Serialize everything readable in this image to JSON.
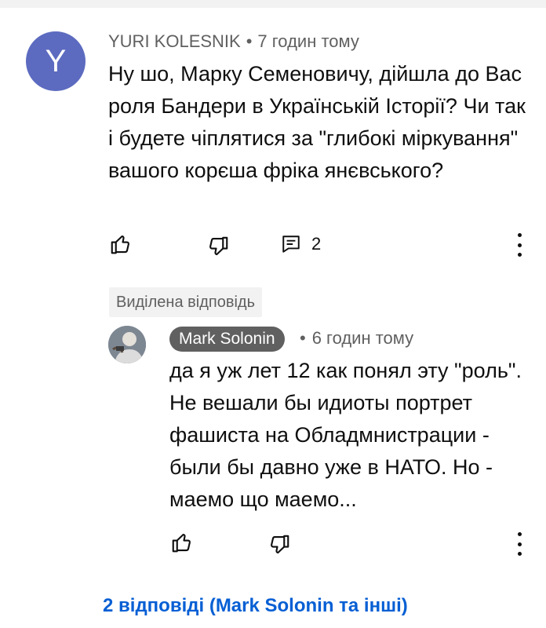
{
  "comment": {
    "avatar_letter": "Y",
    "avatar_color": "#5c6bc0",
    "author": "YURI KOLESNIK",
    "separator": "•",
    "time": "7 годин тому",
    "text": "Ну шо, Марку Семеновичу, дійшла до Вас роля Бандери в Українській Історії? Чи так і будете чіплятися за \"глибокі міркування\" вашого корєша фріка янєвського?",
    "reply_count": "2"
  },
  "pinned": {
    "label": "Виділена відповідь"
  },
  "reply": {
    "author": "Mark Solonin",
    "separator": "•",
    "time": "6 годин тому",
    "text": "да я уж лет 12 как понял эту \"роль\". Не вешали бы идиоты портрет фашиста на Обладмнистрации - были бы давно уже в НАТО. Но - маемо що маемо..."
  },
  "footer": {
    "more_replies": "2 відповіді (Mark Solonin та інші)"
  },
  "colors": {
    "link": "#065fd4",
    "meta": "#606060",
    "author_chip": "#606060"
  },
  "icons": [
    "like-icon",
    "dislike-icon",
    "reply-icon",
    "more-vert-icon"
  ]
}
